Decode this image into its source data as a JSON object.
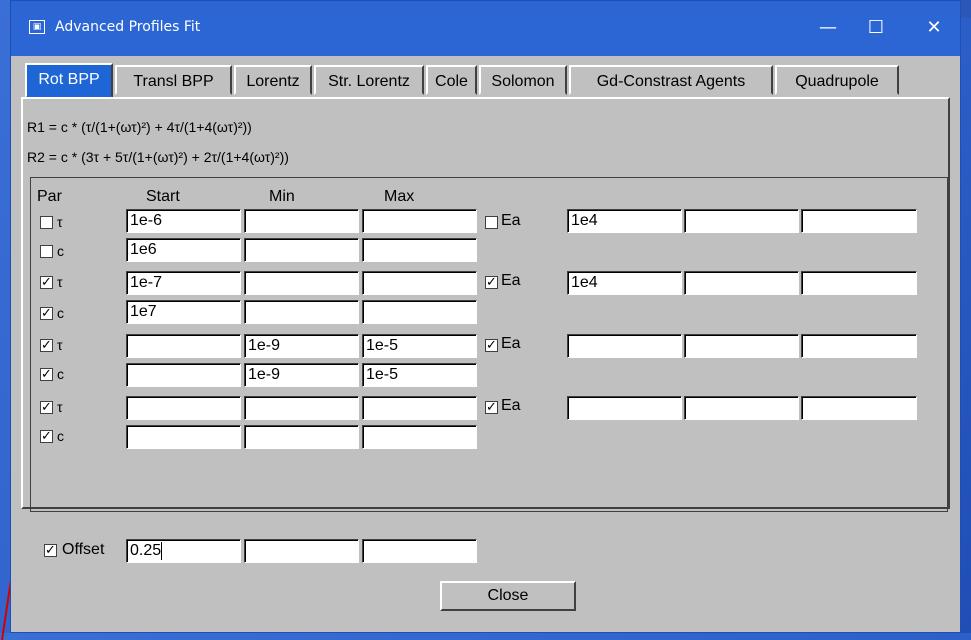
{
  "window": {
    "title": "Advanced Profiles Fit",
    "min": "—",
    "max": "☐",
    "close": "✕"
  },
  "tabs": [
    "Rot BPP",
    "Transl BPP",
    "Lorentz",
    "Str. Lorentz",
    "Cole",
    "Solomon",
    "Gd-Constrast Agents",
    "Quadrupole"
  ],
  "formula": {
    "r1": "R1 = c * (τ/(1+(ωτ)²) + 4τ/(1+4(ωτ)²))",
    "r2": "R2 = c * (3τ + 5τ/(1+(ωτ)²) + 2τ/(1+4(ωτ)²))"
  },
  "headers": {
    "par": "Par",
    "start": "Start",
    "min": "Min",
    "max": "Max"
  },
  "rows": [
    {
      "label": "τ",
      "checked": false,
      "start": "1e-6",
      "min": "",
      "max": "",
      "ea": {
        "label": "Ea",
        "checked": false,
        "v1": "1e4",
        "v2": "",
        "v3": ""
      }
    },
    {
      "label": "c",
      "checked": false,
      "start": "1e6",
      "min": "",
      "max": ""
    },
    {
      "label": "τ",
      "checked": true,
      "start": "1e-7",
      "min": "",
      "max": "",
      "ea": {
        "label": "Ea",
        "checked": true,
        "v1": "1e4",
        "v2": "",
        "v3": ""
      }
    },
    {
      "label": "c",
      "checked": true,
      "start": "1e7",
      "min": "",
      "max": ""
    },
    {
      "label": "τ",
      "checked": true,
      "start": "",
      "min": "1e-9",
      "max": "1e-5",
      "ea": {
        "label": "Ea",
        "checked": true,
        "v1": "",
        "v2": "",
        "v3": ""
      }
    },
    {
      "label": "c",
      "checked": true,
      "start": "",
      "min": "1e-9",
      "max": "1e-5"
    },
    {
      "label": "τ",
      "checked": true,
      "start": "",
      "min": "",
      "max": "",
      "ea": {
        "label": "Ea",
        "checked": true,
        "v1": "",
        "v2": "",
        "v3": ""
      }
    },
    {
      "label": "c",
      "checked": true,
      "start": "",
      "min": "",
      "max": ""
    }
  ],
  "offset": {
    "label": "Offset",
    "checked": true,
    "value": "0.25",
    "min": "",
    "max": ""
  },
  "close_label": "Close",
  "check_glyph": "✓"
}
